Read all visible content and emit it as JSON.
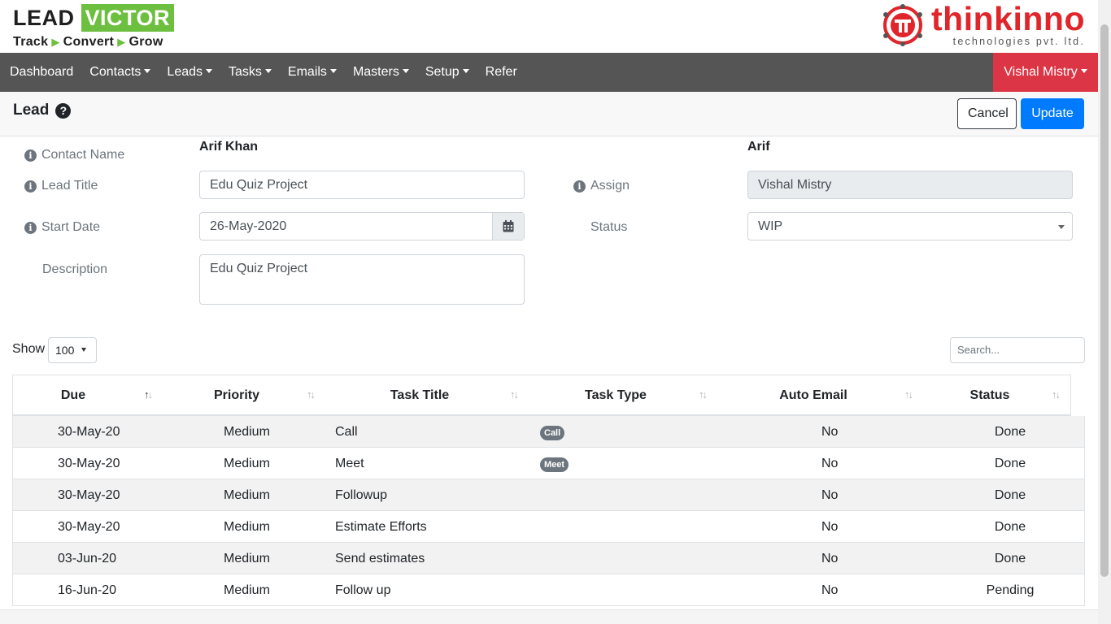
{
  "brand": {
    "lead": "LEAD",
    "victor": "VICTOR",
    "tagline": [
      "Track",
      "Convert",
      "Grow"
    ],
    "partner_name": "thinkinno",
    "partner_sub": "technologies pvt. ltd.",
    "colors": {
      "green": "#6cbf3f",
      "red": "#e0252b"
    }
  },
  "nav": {
    "items": [
      {
        "label": "Dashboard",
        "dropdown": false
      },
      {
        "label": "Contacts",
        "dropdown": true
      },
      {
        "label": "Leads",
        "dropdown": true
      },
      {
        "label": "Tasks",
        "dropdown": true
      },
      {
        "label": "Emails",
        "dropdown": true
      },
      {
        "label": "Masters",
        "dropdown": true
      },
      {
        "label": "Setup",
        "dropdown": true
      },
      {
        "label": "Refer",
        "dropdown": false
      }
    ],
    "user": "Vishal Mistry",
    "bg_color": "#555555",
    "user_color": "#dc3545"
  },
  "header": {
    "title": "Lead",
    "cancel_label": "Cancel",
    "update_label": "Update"
  },
  "form": {
    "contact_name_label": "Contact Name",
    "contact_name_value": "Arif Khan",
    "contact_short": "Arif",
    "lead_title_label": "Lead Title",
    "lead_title_value": "Edu Quiz Project",
    "assign_label": "Assign",
    "assign_value": "Vishal Mistry",
    "start_date_label": "Start Date",
    "start_date_value": "26-May-2020",
    "status_label": "Status",
    "status_value": "WIP",
    "description_label": "Description",
    "description_value": "Edu Quiz Project"
  },
  "table_controls": {
    "show_label": "Show",
    "page_size": "100",
    "search_placeholder": "Search..."
  },
  "table": {
    "columns": [
      "Due",
      "Priority",
      "Task Title",
      "Task Type",
      "Auto Email",
      "Status"
    ],
    "sorted_column": "Due",
    "rows": [
      {
        "due": "30-May-20",
        "priority": "Medium",
        "title": "Call",
        "type": "Call",
        "auto_email": "No",
        "status": "Done"
      },
      {
        "due": "30-May-20",
        "priority": "Medium",
        "title": "Meet",
        "type": "Meet",
        "auto_email": "No",
        "status": "Done"
      },
      {
        "due": "30-May-20",
        "priority": "Medium",
        "title": "Followup",
        "type": "",
        "auto_email": "No",
        "status": "Done"
      },
      {
        "due": "30-May-20",
        "priority": "Medium",
        "title": "Estimate Efforts",
        "type": "",
        "auto_email": "No",
        "status": "Done"
      },
      {
        "due": "03-Jun-20",
        "priority": "Medium",
        "title": "Send estimates",
        "type": "",
        "auto_email": "No",
        "status": "Done"
      },
      {
        "due": "16-Jun-20",
        "priority": "Medium",
        "title": "Follow up",
        "type": "",
        "auto_email": "No",
        "status": "Pending"
      }
    ]
  },
  "accent_color": "#007bff"
}
